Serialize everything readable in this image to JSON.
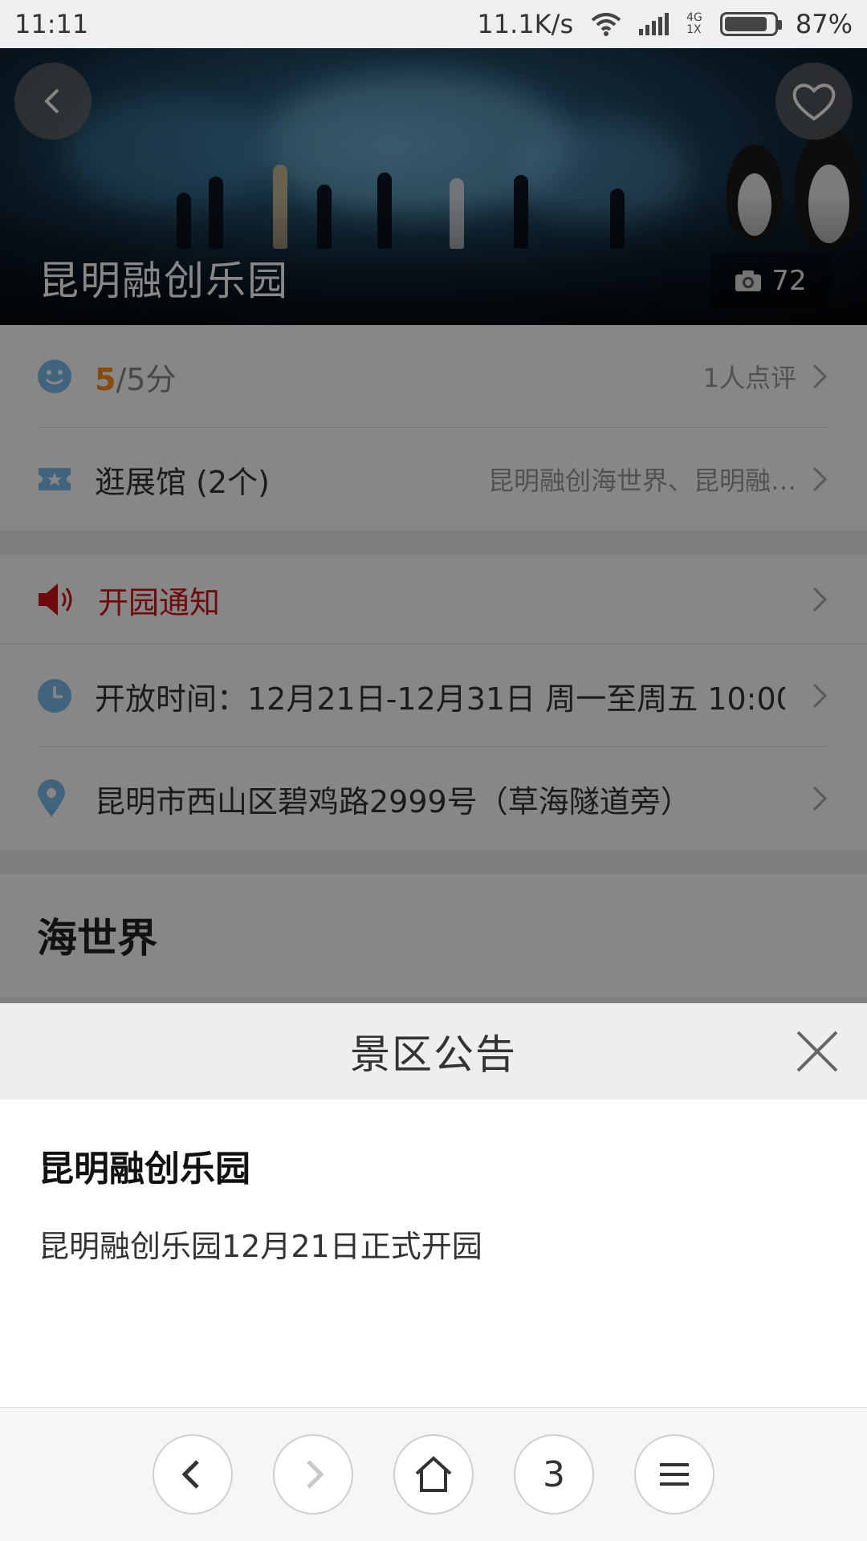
{
  "status_bar": {
    "time": "11:11",
    "network_speed": "11.1K/s",
    "network_type": "4G",
    "network_sub": "1X",
    "battery": "87%",
    "battery_level": 0.87
  },
  "hero": {
    "title": "昆明融创乐园",
    "photo_count": "72"
  },
  "info": {
    "rating": {
      "score": "5",
      "suffix": "/5分",
      "reviews": "1人点评"
    },
    "halls": {
      "label": "逛展馆 (2个)",
      "summary": "昆明融创海世界、昆明融…"
    },
    "notice": {
      "label": "开园通知",
      "color": "#d0141a"
    },
    "hours": {
      "label": "开放时间：12月21日-12月31日 周一至周五 10:00…"
    },
    "address": {
      "label": "昆明市西山区碧鸡路2999号（草海隧道旁）"
    }
  },
  "section": {
    "title": "海世界"
  },
  "sheet": {
    "title": "景区公告",
    "heading": "昆明融创乐园",
    "body": "昆明融创乐园12月21日正式开园"
  },
  "nav": {
    "tabs_count": "3"
  },
  "colors": {
    "accent_orange": "#ff8c1a",
    "icon_blue": "#7bbcea",
    "notice_red": "#d0141a"
  }
}
